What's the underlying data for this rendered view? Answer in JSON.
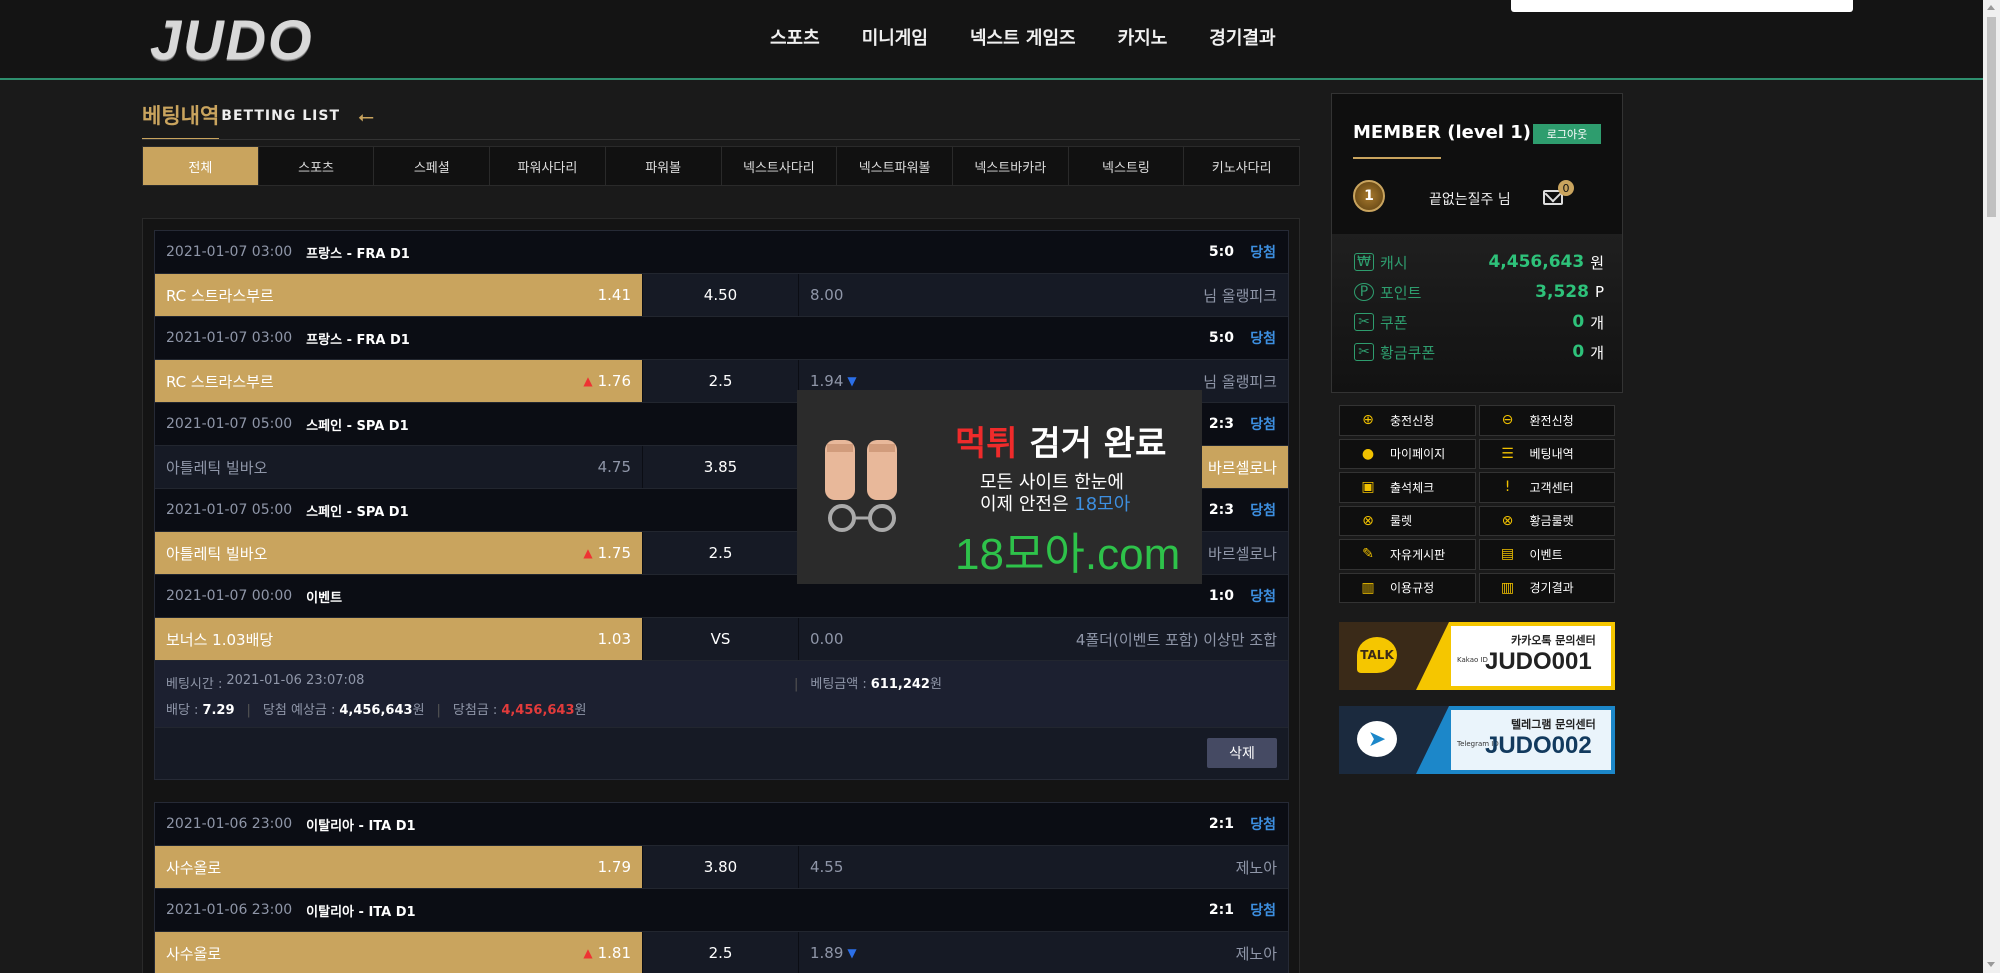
{
  "header": {
    "logo_text": "JUDO",
    "nav": [
      "스포츠",
      "미니게임",
      "넥스트 게임즈",
      "카지노",
      "경기결과"
    ]
  },
  "section": {
    "title_ko": "베팅내역",
    "title_en": "BETTING LIST",
    "back_icon": "arrow-left-icon"
  },
  "tabs": [
    "전체",
    "스포츠",
    "스페셜",
    "파워사다리",
    "파워볼",
    "넥스트사다리",
    "넥스트파워볼",
    "넥스트바카라",
    "넥스트링",
    "키노사다리"
  ],
  "active_tab": "전체",
  "bets": [
    {
      "rows": [
        {
          "date": "2021-01-07 03:00",
          "league": "프랑스 - FRA D1",
          "score": "5:0",
          "result": "당첨",
          "home": "RC 스트라스부르",
          "home_odds": "1.41",
          "draw": "4.50",
          "away_odds": "8.00",
          "away": "님 올랭피크",
          "selected": "home",
          "home_trend": "",
          "away_trend": ""
        },
        {
          "date": "2021-01-07 03:00",
          "league": "프랑스 - FRA D1",
          "score": "5:0",
          "result": "당첨",
          "home": "RC 스트라스부르",
          "home_odds": "1.76",
          "draw": "2.5",
          "away_odds": "1.94",
          "away": "님 올랭피크",
          "selected": "home",
          "home_trend": "up",
          "away_trend": "down"
        },
        {
          "date": "2021-01-07 05:00",
          "league": "스페인 - SPA D1",
          "score": "2:3",
          "result": "당첨",
          "home": "아틀레틱 빌바오",
          "home_odds": "4.75",
          "draw": "3.85",
          "away_odds": "",
          "away": "바르셀로나",
          "selected": "away",
          "home_trend": "",
          "away_trend": ""
        },
        {
          "date": "2021-01-07 05:00",
          "league": "스페인 - SPA D1",
          "score": "2:3",
          "result": "당첨",
          "home": "아틀레틱 빌바오",
          "home_odds": "1.75",
          "draw": "2.5",
          "away_odds": "",
          "away": "바르셀로나",
          "selected": "home",
          "home_trend": "up",
          "away_trend": ""
        },
        {
          "date": "2021-01-07 00:00",
          "league": "이벤트",
          "score": "1:0",
          "result": "당첨",
          "home": "보너스 1.03배당",
          "home_odds": "1.03",
          "draw": "VS",
          "away_odds": "0.00",
          "away": "4폴더(이벤트 포함) 이상만 조합",
          "selected": "home",
          "home_trend": "",
          "away_trend": ""
        }
      ],
      "summary": {
        "bet_time_label": "베팅시간 :",
        "bet_time": "2021-01-06 23:07:08",
        "amount_label": "베팅금액 :",
        "amount": "611,242",
        "won_unit": "원",
        "odds_label": "배당 :",
        "odds": "7.29",
        "expected_label": "당첨 예상금 :",
        "expected": "4,456,643",
        "payout_label": "당첨금 :",
        "payout": "4,456,643"
      },
      "delete_label": "삭제"
    },
    {
      "rows": [
        {
          "date": "2021-01-06 23:00",
          "league": "이탈리아 - ITA D1",
          "score": "2:1",
          "result": "당첨",
          "home": "사수올로",
          "home_odds": "1.79",
          "draw": "3.80",
          "away_odds": "4.55",
          "away": "제노아",
          "selected": "home",
          "home_trend": "",
          "away_trend": ""
        },
        {
          "date": "2021-01-06 23:00",
          "league": "이탈리아 - ITA D1",
          "score": "2:1",
          "result": "당첨",
          "home": "사수올로",
          "home_odds": "1.81",
          "draw": "2.5",
          "away_odds": "1.89",
          "away": "제노아",
          "selected": "home",
          "home_trend": "up",
          "away_trend": "down"
        }
      ]
    }
  ],
  "ad": {
    "title_red": "먹튀",
    "title_rest": " 검거 완료",
    "line1": "모든 사이트 한눈에",
    "line2_a": "이제 안전은 ",
    "line2_b": "18모아",
    "domain": "18모아.com"
  },
  "member": {
    "title": "MEMBER (level 1)",
    "logout": "로그아웃",
    "level": "1",
    "nickname": "끝없는질주 님",
    "mail_count": "0",
    "wallet": [
      {
        "icon": "cash-icon",
        "label": "캐시",
        "value": "4,456,643",
        "unit": "원"
      },
      {
        "icon": "point-icon",
        "label": "포인트",
        "value": "3,528",
        "unit": "P"
      },
      {
        "icon": "coupon-icon",
        "label": "쿠폰",
        "value": "0",
        "unit": "개"
      },
      {
        "icon": "gold-coupon-icon",
        "label": "황금쿠폰",
        "value": "0",
        "unit": "개"
      }
    ]
  },
  "quick_menu": [
    {
      "icon": "plus-circle-icon",
      "glyph": "⊕",
      "label": "충전신청"
    },
    {
      "icon": "minus-circle-icon",
      "glyph": "⊖",
      "label": "환전신청"
    },
    {
      "icon": "user-icon",
      "glyph": "●",
      "label": "마이페이지"
    },
    {
      "icon": "list-icon",
      "glyph": "☰",
      "label": "베팅내역"
    },
    {
      "icon": "calendar-icon",
      "glyph": "▣",
      "label": "출석체크"
    },
    {
      "icon": "alert-icon",
      "glyph": "!",
      "label": "고객센터"
    },
    {
      "icon": "roulette-icon",
      "glyph": "⊗",
      "label": "룰렛"
    },
    {
      "icon": "gold-roulette-icon",
      "glyph": "⊗",
      "label": "황금룰렛"
    },
    {
      "icon": "pencil-icon",
      "glyph": "✎",
      "label": "자유게시판"
    },
    {
      "icon": "gift-icon",
      "glyph": "▤",
      "label": "이벤트"
    },
    {
      "icon": "book-icon",
      "glyph": "▥",
      "label": "이용규정"
    },
    {
      "icon": "book-icon",
      "glyph": "▥",
      "label": "경기결과"
    }
  ],
  "banners": {
    "kakao": {
      "logo": "TALK",
      "sub": "카카오톡 문의센터",
      "id_label": "Kakao ID",
      "id": "JUDO001"
    },
    "telegram": {
      "logo": "➤",
      "sub": "텔레그램 문의센터",
      "id_label": "Telegram ID",
      "id": "JUDO002"
    }
  }
}
